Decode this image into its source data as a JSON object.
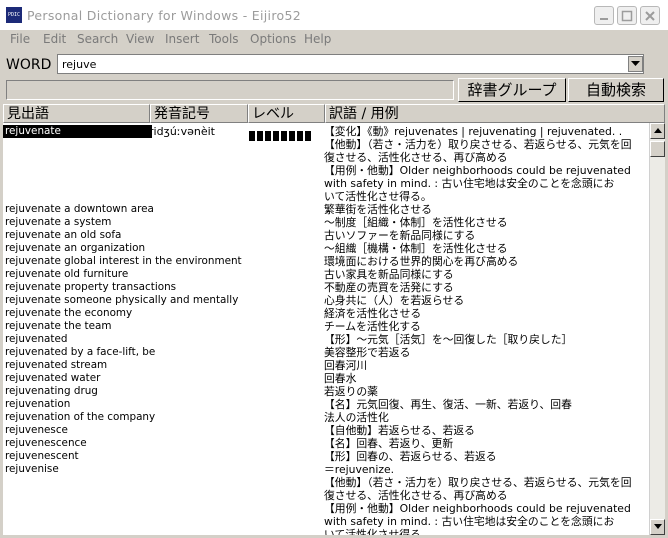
{
  "window": {
    "title": "Personal Dictionary for Windows - Eijiro52",
    "icon_text": "PDIC"
  },
  "menu": [
    "File",
    "Edit",
    "Search",
    "View",
    "Insert",
    "Tools",
    "Options",
    "Help"
  ],
  "word": {
    "label": "WORD",
    "value": "rejuve"
  },
  "buttons": {
    "dict_group": "辞書グループ",
    "auto_search": "自動検索"
  },
  "columns": {
    "headword": "見出語",
    "pronunciation": "発音記号",
    "level": "レベル",
    "translation": "訳語 / 用例"
  },
  "selected": {
    "pronunciation": "ridʒúːvənèit",
    "level_blocks": 8
  },
  "headwords": [
    "rejuvenate",
    "rejuvenate a downtown area",
    "rejuvenate a system",
    "rejuvenate an old sofa",
    "rejuvenate an organization",
    "rejuvenate global interest in the environment",
    "rejuvenate old furniture",
    "rejuvenate property transactions",
    "rejuvenate someone physically and mentally",
    "rejuvenate the economy",
    "rejuvenate the team",
    "rejuvenated",
    "rejuvenated by a face-lift, be",
    "rejuvenated stream",
    "rejuvenated water",
    "rejuvenating drug",
    "rejuvenation",
    "rejuvenation of the company",
    "rejuvenesce",
    "rejuvenescence",
    "rejuvenescent",
    "rejuvenise"
  ],
  "translations": [
    "【変化】《動》rejuvenates | rejuvenating | rejuvenated. .",
    "【他動】（若さ・活力を）取り戻させる、若返らせる、元気を回",
    "復させる、活性化させる、再び高める",
    "【用例・他動】Older neighborhoods could be rejuvenated",
    "with safety in mind. : 古い住宅地は安全のことを念頭にお",
    "いて活性化させ得る。",
    "繁華街を活性化させる",
    "～制度［組織・体制］を活性化させる",
    "古いソファーを新品同様にする",
    "～組織［機構・体制］を活性化させる",
    "環境面における世界的関心を再び高める",
    "古い家具を新品同様にする",
    "不動産の売買を活発にする",
    "心身共に（人）を若返らせる",
    "経済を活性化させる",
    "チームを活性化する",
    "【形】～元気［活気］を～回復した［取り戻した］",
    "美容整形で若返る",
    "回春河川",
    "回春水",
    "若返りの薬",
    "【名】元気回復、再生、復活、一新、若返り、回春",
    "法人の活性化",
    "【自他動】若返らせる、若返る",
    "【名】回春、若返り、更新",
    "【形】回春の、若返らせる、若返る",
    "＝rejuvenize.",
    "【他動】（若さ・活力を）取り戻させる、若返らせる、元気を回",
    "復させる、活性化させる、再び高める",
    "【用例・他動】Older neighborhoods could be rejuvenated",
    "with safety in mind. : 古い住宅地は安全のことを念頭にお",
    "いて活性化させ得る"
  ]
}
